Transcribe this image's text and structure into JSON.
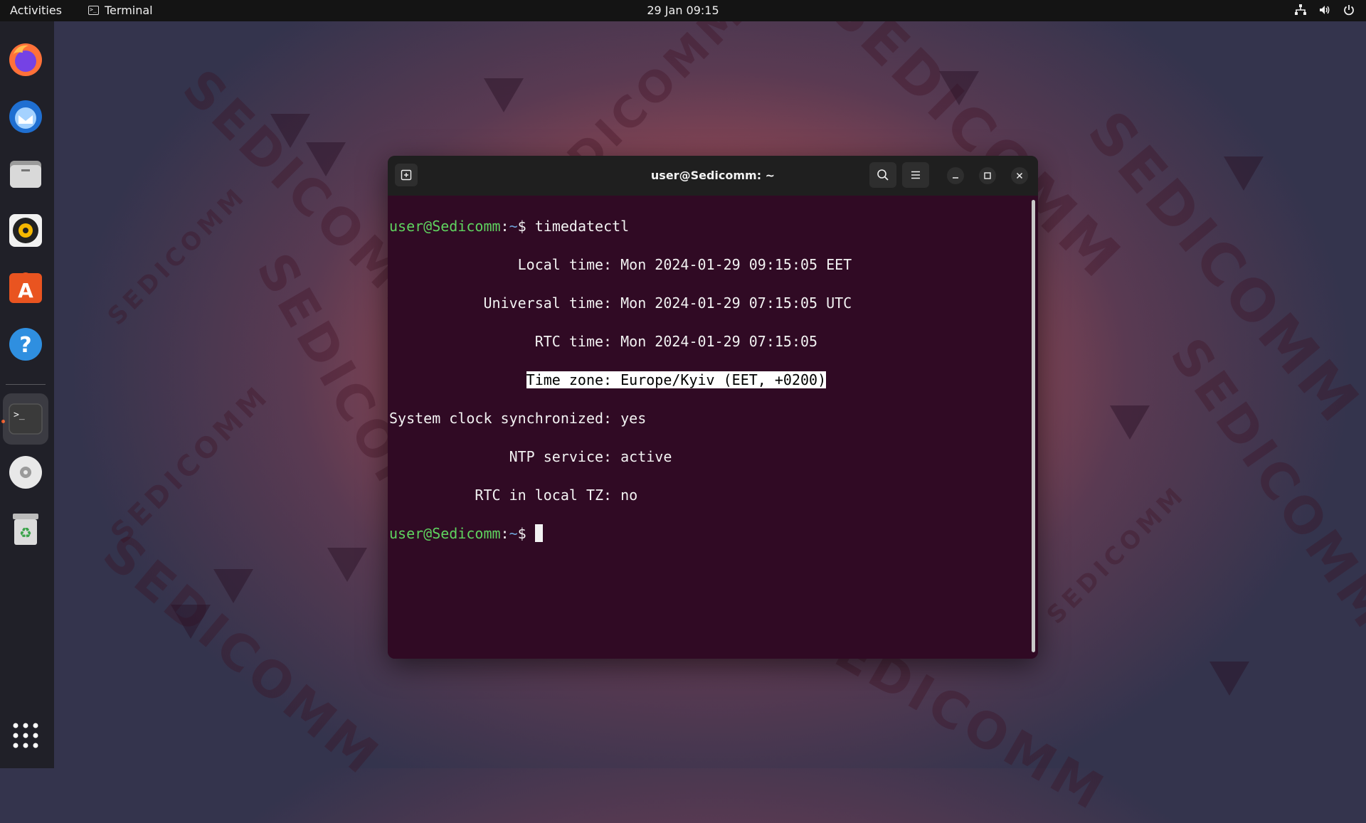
{
  "topbar": {
    "activities": "Activities",
    "app_name": "Terminal",
    "clock": "29 Jan  09:15",
    "tray_icons": [
      "network-icon",
      "volume-icon",
      "power-icon"
    ]
  },
  "wallpaper": {
    "watermark": "SEDICOMM"
  },
  "dock": {
    "items": [
      "firefox-icon",
      "thunderbird-icon",
      "files-icon",
      "rhythmbox-icon",
      "app-center-icon",
      "help-icon",
      "terminal-icon",
      "disc-icon",
      "trash-icon",
      "show-apps-icon"
    ],
    "running_indicator_color": "#e95420"
  },
  "terminal": {
    "title": "user@Sedicomm: ~",
    "prompt_user": "user@Sedicomm",
    "prompt_sep": ":",
    "prompt_path": "~",
    "prompt_symbol": "$ ",
    "command": "timedatectl",
    "output": [
      {
        "label": "               Local time:",
        "value": " Mon 2024-01-29 09:15:05 EET"
      },
      {
        "label": "           Universal time:",
        "value": " Mon 2024-01-29 07:15:05 UTC"
      },
      {
        "label": "                 RTC time:",
        "value": " Mon 2024-01-29 07:15:05"
      },
      {
        "label_pad": "                ",
        "label": "Time zone:",
        "value": " Europe/Kyiv (EET, +0200)"
      },
      {
        "label": "System clock synchronized:",
        "value": " yes"
      },
      {
        "label": "              NTP service:",
        "value": " active"
      },
      {
        "label": "          RTC in local TZ:",
        "value": " no"
      }
    ],
    "colors": {
      "background": "#300a24",
      "prompt_user": "#5fd35f",
      "prompt_path": "#6fa3d8",
      "text": "#f2f2f2"
    }
  }
}
